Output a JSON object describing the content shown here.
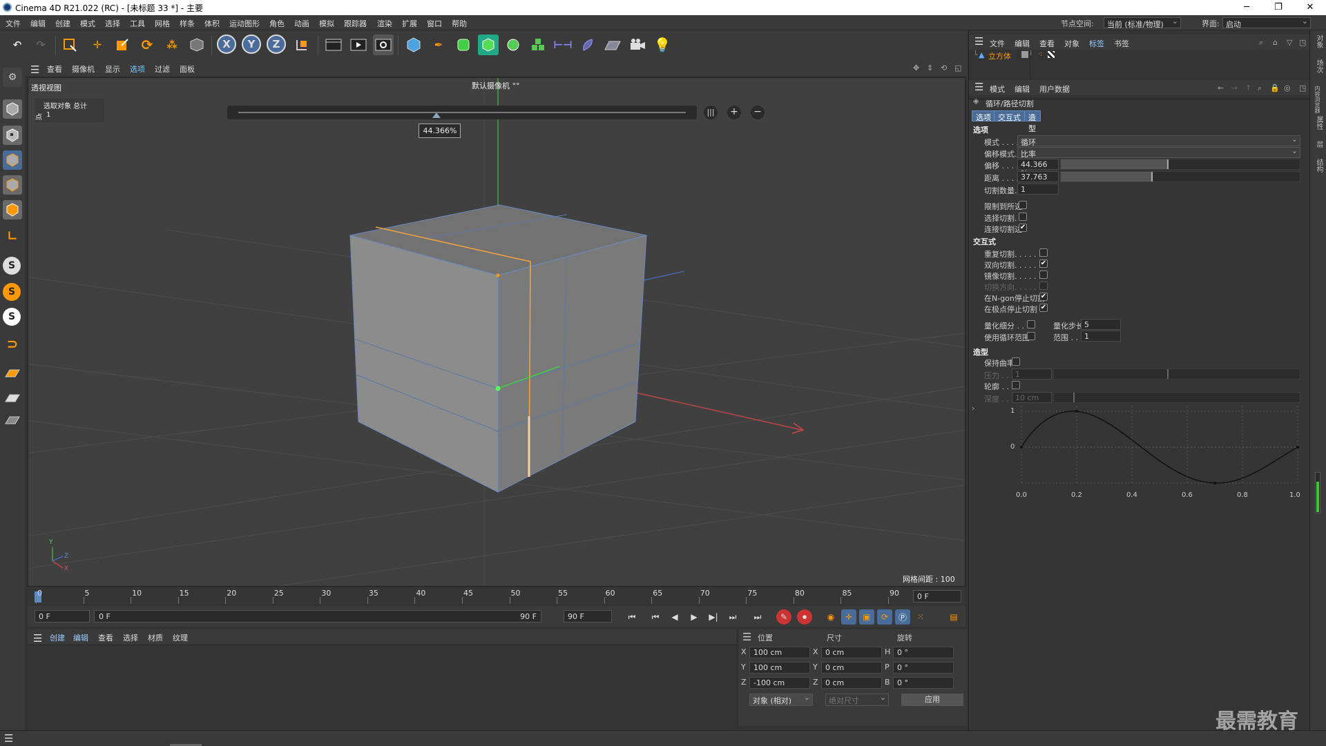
{
  "window": {
    "title": "Cinema 4D R21.022 (RC) - [未标题 33 *] - 主要",
    "minimize": "─",
    "maximize": "❐",
    "close": "✕"
  },
  "menubar": {
    "items": [
      "文件",
      "编辑",
      "创建",
      "模式",
      "选择",
      "工具",
      "网格",
      "样条",
      "体积",
      "运动图形",
      "角色",
      "动画",
      "模拟",
      "跟踪器",
      "渲染",
      "扩展",
      "窗口",
      "帮助"
    ],
    "node_space_label": "节点空间:",
    "node_space_value": "当前 (标准/物理)",
    "layout_label": "界面:",
    "layout_value": "启动"
  },
  "toolbar": {
    "icons": [
      "undo-icon",
      "redo-icon",
      "live-select-icon",
      "move-icon",
      "scale-icon",
      "rotate-icon",
      "recent-tools-icon",
      "object-mode-icon",
      "x-axis-icon",
      "y-axis-icon",
      "z-axis-icon",
      "coordinate-system-icon",
      "render-view-icon",
      "render-to-picture-viewer-icon",
      "render-settings-icon",
      "cube-icon",
      "pen-icon",
      "subdivision-icon",
      "extrude-icon",
      "cloner-icon",
      "mograph-icon",
      "symmetry-icon",
      "deformer-icon",
      "floor-icon",
      "camera-icon",
      "light-icon"
    ],
    "x": "X",
    "y": "Y",
    "z": "Z"
  },
  "viewport": {
    "menu": [
      "查看",
      "摄像机",
      "显示",
      "选项",
      "过滤",
      "面板"
    ],
    "name": "透视视图",
    "camera": "默认摄像机 °°",
    "hud_selected": "选取对象 总计",
    "hud_points_label": "点",
    "hud_points_value": "1",
    "offset_badge": "44.366%",
    "grid_spacing": "网格间距 : 100 cm",
    "axis_y": "Y",
    "axis_z": "Z",
    "axis_x": "X",
    "slider_fraction": 0.44366
  },
  "timeline": {
    "ticks": [
      "0",
      "5",
      "10",
      "15",
      "20",
      "25",
      "30",
      "35",
      "40",
      "45",
      "50",
      "55",
      "60",
      "65",
      "70",
      "75",
      "80",
      "85",
      "90"
    ],
    "current": "0 F"
  },
  "transport": {
    "start": "0 F",
    "range_start": "0 F",
    "range_end": "90 F",
    "end": "90 F"
  },
  "material": {
    "menu": [
      "创建",
      "编辑",
      "查看",
      "选择",
      "材质",
      "纹理"
    ]
  },
  "coords": {
    "headers": [
      "位置",
      "尺寸",
      "旋转"
    ],
    "rows": [
      {
        "axis": "X",
        "pos": "100 cm",
        "size_axis": "X",
        "size": "0 cm",
        "rot_axis": "H",
        "rot": "0 °"
      },
      {
        "axis": "Y",
        "pos": "100 cm",
        "size_axis": "Y",
        "size": "0 cm",
        "rot_axis": "P",
        "rot": "0 °"
      },
      {
        "axis": "Z",
        "pos": "-100 cm",
        "size_axis": "Z",
        "size": "0 cm",
        "rot_axis": "B",
        "rot": "0 °"
      }
    ],
    "mode": "对象 (相对)",
    "size_mode": "绝对尺寸",
    "apply": "应用"
  },
  "objects": {
    "menu": [
      "文件",
      "编辑",
      "查看",
      "对象",
      "标签",
      "书签"
    ],
    "items": [
      {
        "name": "立方体"
      }
    ]
  },
  "attributes": {
    "menu": [
      "模式",
      "编辑",
      "用户数据"
    ],
    "tool_name": "循环/路径切割",
    "tabs": [
      "选项",
      "交互式",
      "造型"
    ],
    "options": {
      "title": "选项",
      "mode_label": "模式 . . . . .",
      "mode_value": "循环",
      "offset_mode_label": "偏移模式. .",
      "offset_mode_value": "比率",
      "offset_label": "偏移 . . . . .",
      "offset_value": "44.366 %",
      "offset_fraction": 0.44366,
      "distance_label": "距离 . . . . .",
      "distance_value": "37.763 cm",
      "distance_fraction": 0.38,
      "cuts_label": "切割数量. . .",
      "cuts_value": "1",
      "checks": [
        {
          "label": "限制到所选",
          "checked": false
        },
        {
          "label": "选择切割. .",
          "checked": false
        },
        {
          "label": "连接切割边",
          "checked": true
        }
      ]
    },
    "interactive": {
      "title": "交互式",
      "checks": [
        {
          "label": "重复切割. . . . . .",
          "checked": false,
          "dim": false
        },
        {
          "label": "双向切割. . . . . .",
          "checked": true,
          "dim": false
        },
        {
          "label": "镜像切割. . . . . .",
          "checked": false,
          "dim": false
        },
        {
          "label": "切换方向. . . . . .",
          "checked": false,
          "dim": true
        },
        {
          "label": "在N-gon停止切割",
          "checked": true,
          "dim": false
        },
        {
          "label": "在极点停止切割 .",
          "checked": true,
          "dim": false
        }
      ],
      "quantize_label": "量化细分 . . .",
      "quantize_checked": false,
      "step_label": "量化步长",
      "step_value": "5",
      "range_check_label": "使用循环范围",
      "range_checked": false,
      "range_label": "范围 . . .",
      "range_value": "1"
    },
    "shaping": {
      "title": "造型",
      "keep_curve_label": "保持曲率",
      "keep_curve_checked": false,
      "pressure_label": "压力 . . .",
      "pressure_value": "1",
      "profile_label": "轮廓 . . .",
      "profile_checked": false,
      "depth_label": "深度 . . .",
      "depth_value": "10 cm"
    },
    "graph": {
      "y_labels": [
        "1",
        "0"
      ],
      "x_labels": [
        "0.0",
        "0.2",
        "0.4",
        "0.6",
        "0.8",
        "1.0"
      ]
    }
  },
  "side_tabs": [
    "对象",
    "场次",
    "内容浏览器",
    "属性",
    "层",
    "结构"
  ],
  "watermark": "最需教育"
}
